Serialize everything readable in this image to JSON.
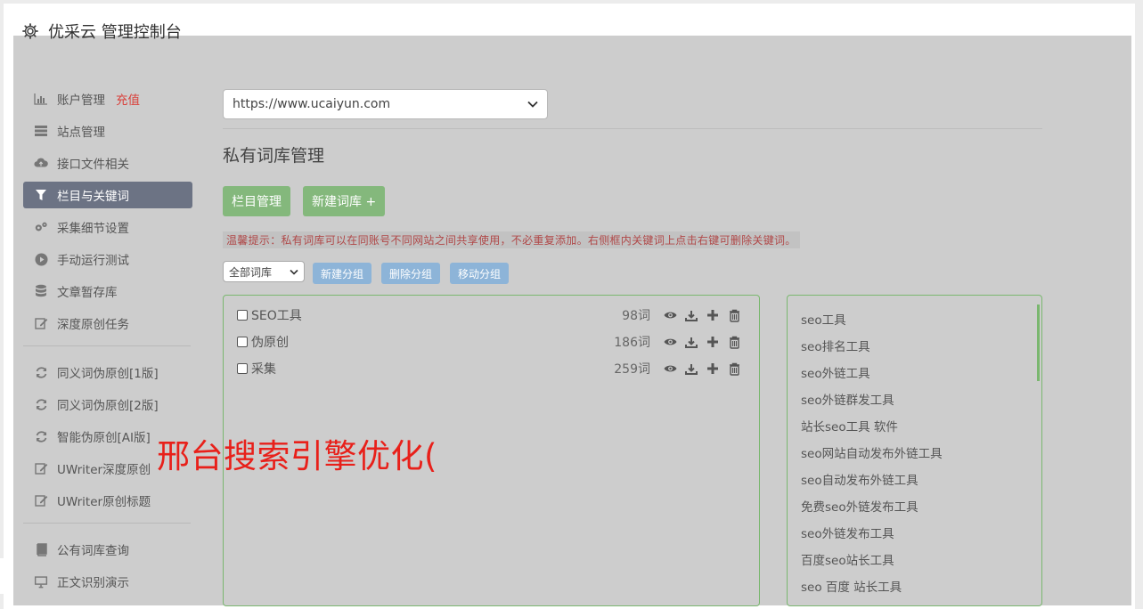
{
  "header": {
    "title": "优采云 管理控制台",
    "icon": "gear-icon"
  },
  "sidebar": {
    "items": [
      {
        "label": "账户管理",
        "badge": "充值",
        "icon": "bar-chart-icon"
      },
      {
        "label": "站点管理",
        "icon": "server-icon"
      },
      {
        "label": "接口文件相关",
        "icon": "cloud-upload-icon"
      },
      {
        "label": "栏目与关键词",
        "icon": "filter-icon",
        "active": true
      },
      {
        "label": "采集细节设置",
        "icon": "cogs-icon"
      },
      {
        "label": "手动运行测试",
        "icon": "play-circle-icon"
      },
      {
        "label": "文章暂存库",
        "icon": "database-icon"
      },
      {
        "label": "深度原创任务",
        "icon": "edit-icon"
      },
      {
        "label": "同义词伪原创[1版]",
        "icon": "refresh-icon"
      },
      {
        "label": "同义词伪原创[2版]",
        "icon": "refresh-icon"
      },
      {
        "label": "智能伪原创[AI版]",
        "icon": "refresh-icon"
      },
      {
        "label": "UWriter深度原创",
        "icon": "edit-icon"
      },
      {
        "label": "UWriter原创标题",
        "icon": "edit-icon"
      },
      {
        "label": "公有词库查询",
        "icon": "book-icon"
      },
      {
        "label": "正文识别演示",
        "icon": "monitor-icon"
      }
    ]
  },
  "main": {
    "site_select": "https://www.ucaiyun.com",
    "section_title": "私有词库管理",
    "btn_column": "栏目管理",
    "btn_new_lib": "新建词库 +",
    "tip": "温馨提示：私有词库可以在同账号不同网站之间共享使用，不必重复添加。右侧框内关键词上点击右键可删除关键词。",
    "group_select": "全部词库",
    "btn_new_group": "新建分组",
    "btn_delete_group": "删除分组",
    "btn_move_group": "移动分组",
    "libraries": [
      {
        "name": "SEO工具",
        "count": "98词"
      },
      {
        "name": "伪原创",
        "count": "186词"
      },
      {
        "name": "采集",
        "count": "259词"
      }
    ],
    "keywords": [
      "seo工具",
      "seo排名工具",
      "seo外链工具",
      "seo外链群发工具",
      "站长seo工具 软件",
      "seo网站自动发布外链工具",
      "seo自动发布外链工具",
      "免费seo外链发布工具",
      "seo外链发布工具",
      "百度seo站长工具",
      "seo 百度 站长工具"
    ]
  },
  "overlay": {
    "text": "邢台搜索引擎优化("
  },
  "colors": {
    "accent_green": "#84b87c",
    "accent_blue": "#8db4d8",
    "active_nav": "#6c7384",
    "recharge": "#d9403a",
    "overlay": "#e8201a"
  }
}
